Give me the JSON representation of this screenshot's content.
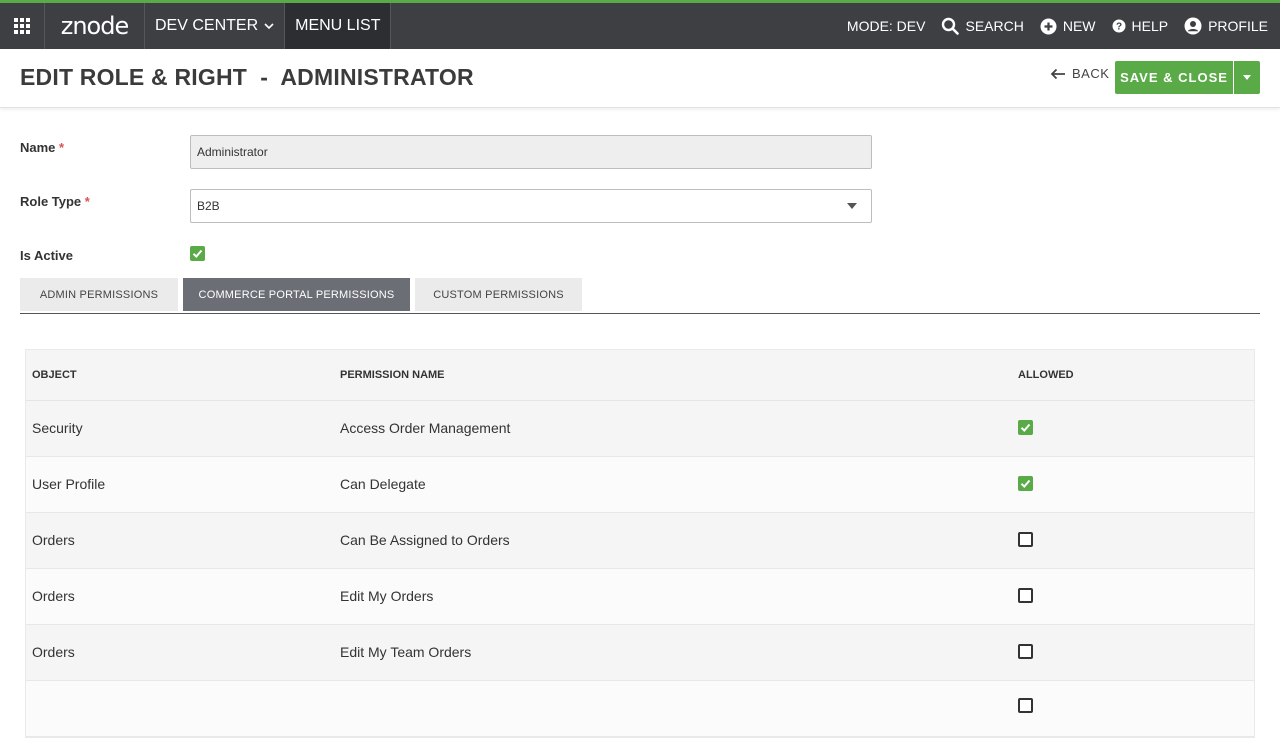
{
  "topbar": {
    "logo": "znode",
    "nav": [
      {
        "label": "DEV CENTER",
        "has_dropdown": true
      },
      {
        "label": "MENU LIST",
        "has_dropdown": false
      }
    ],
    "mode": "MODE: DEV",
    "search": "SEARCH",
    "new": "NEW",
    "help": "HELP",
    "profile": "PROFILE"
  },
  "header": {
    "title": "EDIT ROLE & RIGHT  -  ADMINISTRATOR",
    "back_label": "BACK",
    "save_label": "SAVE & CLOSE"
  },
  "form": {
    "name_label": "Name",
    "name_value": "Administrator",
    "role_type_label": "Role Type",
    "role_type_value": "B2B",
    "is_active_label": "Is Active",
    "is_active": true,
    "required_mark": "*"
  },
  "tabs": [
    {
      "label": "ADMIN PERMISSIONS",
      "active": false
    },
    {
      "label": "COMMERCE PORTAL PERMISSIONS",
      "active": true
    },
    {
      "label": "CUSTOM PERMISSIONS",
      "active": false
    }
  ],
  "table": {
    "columns": [
      "OBJECT",
      "PERMISSION NAME",
      "ALLOWED"
    ],
    "rows": [
      {
        "object": "Security",
        "permission": "Access Order Management",
        "allowed": true
      },
      {
        "object": "User Profile",
        "permission": "Can Delegate",
        "allowed": true
      },
      {
        "object": "Orders",
        "permission": "Can Be Assigned to Orders",
        "allowed": false
      },
      {
        "object": "Orders",
        "permission": "Edit My Orders",
        "allowed": false
      },
      {
        "object": "Orders",
        "permission": "Edit My Team Orders",
        "allowed": false
      }
    ]
  },
  "colors": {
    "accent": "#5aaa47",
    "topbar": "#3d3f43",
    "active_tab": "#6b6f75"
  }
}
